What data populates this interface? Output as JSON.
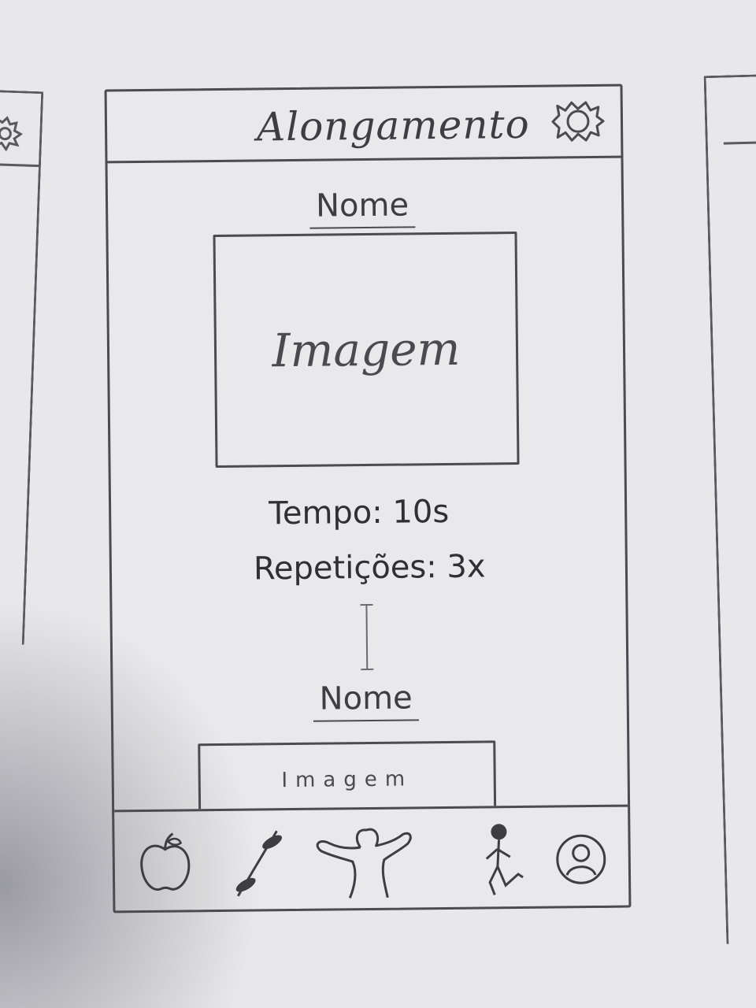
{
  "header": {
    "title": "Alongamento",
    "settings_icon": "gear-icon"
  },
  "exercises": [
    {
      "name": "Nome",
      "image_label": "Imagem",
      "tempo": "Tempo: 10s",
      "repeticoes": "Repetições: 3x"
    },
    {
      "name": "Nome",
      "image_label": "Imagem"
    }
  ],
  "bottom_nav": {
    "items": [
      {
        "icon": "apple-icon"
      },
      {
        "icon": "barbell-icon"
      },
      {
        "icon": "stretching-person-icon"
      },
      {
        "icon": "running-person-icon"
      },
      {
        "icon": "profile-icon"
      }
    ]
  },
  "colors": {
    "paper": "#e8e7ea",
    "pencil": "#4b4b50"
  }
}
